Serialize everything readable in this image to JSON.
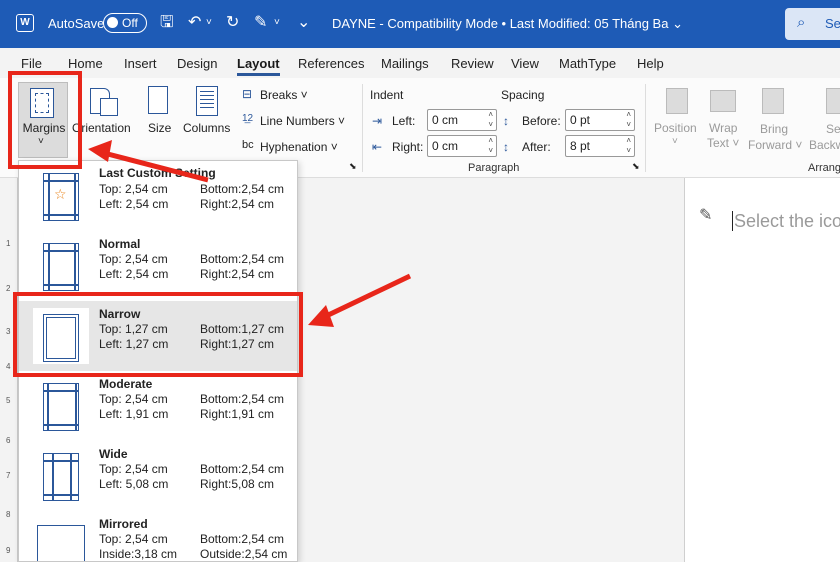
{
  "titlebar": {
    "autosave_label": "AutoSave",
    "autosave_state": "Off",
    "title": "DAYNE  -  Compatibility Mode  •  Last Modified: 05 Tháng Ba  ⌄",
    "search_label": "Se"
  },
  "menu": {
    "tabs": [
      "File",
      "Home",
      "Insert",
      "Design",
      "Layout",
      "References",
      "Mailings",
      "Review",
      "View",
      "MathType",
      "Help"
    ],
    "active_tab": "Layout"
  },
  "ribbon": {
    "margins": "Margins",
    "orientation": "Orientation",
    "size": "Size",
    "columns": "Columns",
    "breaks": "Breaks ˅",
    "line_numbers": "Line Numbers ˅",
    "hyphenation": "Hyphenation ˅",
    "indent_label": "Indent",
    "spacing_label": "Spacing",
    "left_label": "Left:",
    "right_label": "Right:",
    "before_label": "Before:",
    "after_label": "After:",
    "indent_left": "0 cm",
    "indent_right": "0 cm",
    "spacing_before": "0 pt",
    "spacing_after": "8 pt",
    "paragraph_label": "Paragraph",
    "position": "Position",
    "wrap_text": "Wrap",
    "wrap_text2": "Text ˅",
    "bring_forward": "Bring",
    "bring_forward2": "Forward ˅",
    "send_backward": "Se",
    "send_backward2": "Backw",
    "arrange_label": "Arrang"
  },
  "document": {
    "placeholder": "Select the ico"
  },
  "margins_menu": [
    {
      "name": "Last Custom Setting",
      "l1": "Top:  2,54 cm",
      "l2": "Left:  2,54 cm",
      "r1": "Bottom:2,54 cm",
      "r2": "Right:2,54 cm"
    },
    {
      "name": "Normal",
      "l1": "Top:  2,54 cm",
      "l2": "Left:  2,54 cm",
      "r1": "Bottom:2,54 cm",
      "r2": "Right:2,54 cm"
    },
    {
      "name": "Narrow",
      "l1": "Top:  1,27 cm",
      "l2": "Left:  1,27 cm",
      "r1": "Bottom:1,27 cm",
      "r2": "Right:1,27 cm"
    },
    {
      "name": "Moderate",
      "l1": "Top:  2,54 cm",
      "l2": "Left:  1,91 cm",
      "r1": "Bottom:2,54 cm",
      "r2": "Right:1,91 cm"
    },
    {
      "name": "Wide",
      "l1": "Top:  2,54 cm",
      "l2": "Left:  5,08 cm",
      "r1": "Bottom:2,54 cm",
      "r2": "Right:5,08 cm"
    },
    {
      "name": "Mirrored",
      "l1": "Top:  2,54 cm",
      "l2": "Inside:3,18 cm",
      "r1": "Bottom:2,54 cm",
      "r2": "Outside:2,54 cm"
    }
  ],
  "ruler_numbers": [
    "1",
    "2",
    "3",
    "4",
    "5",
    "6",
    "7",
    "8",
    "9"
  ],
  "colors": {
    "titlebar": "#1e5bb6",
    "annotation": "#e8261a",
    "accent": "#2b579a"
  }
}
